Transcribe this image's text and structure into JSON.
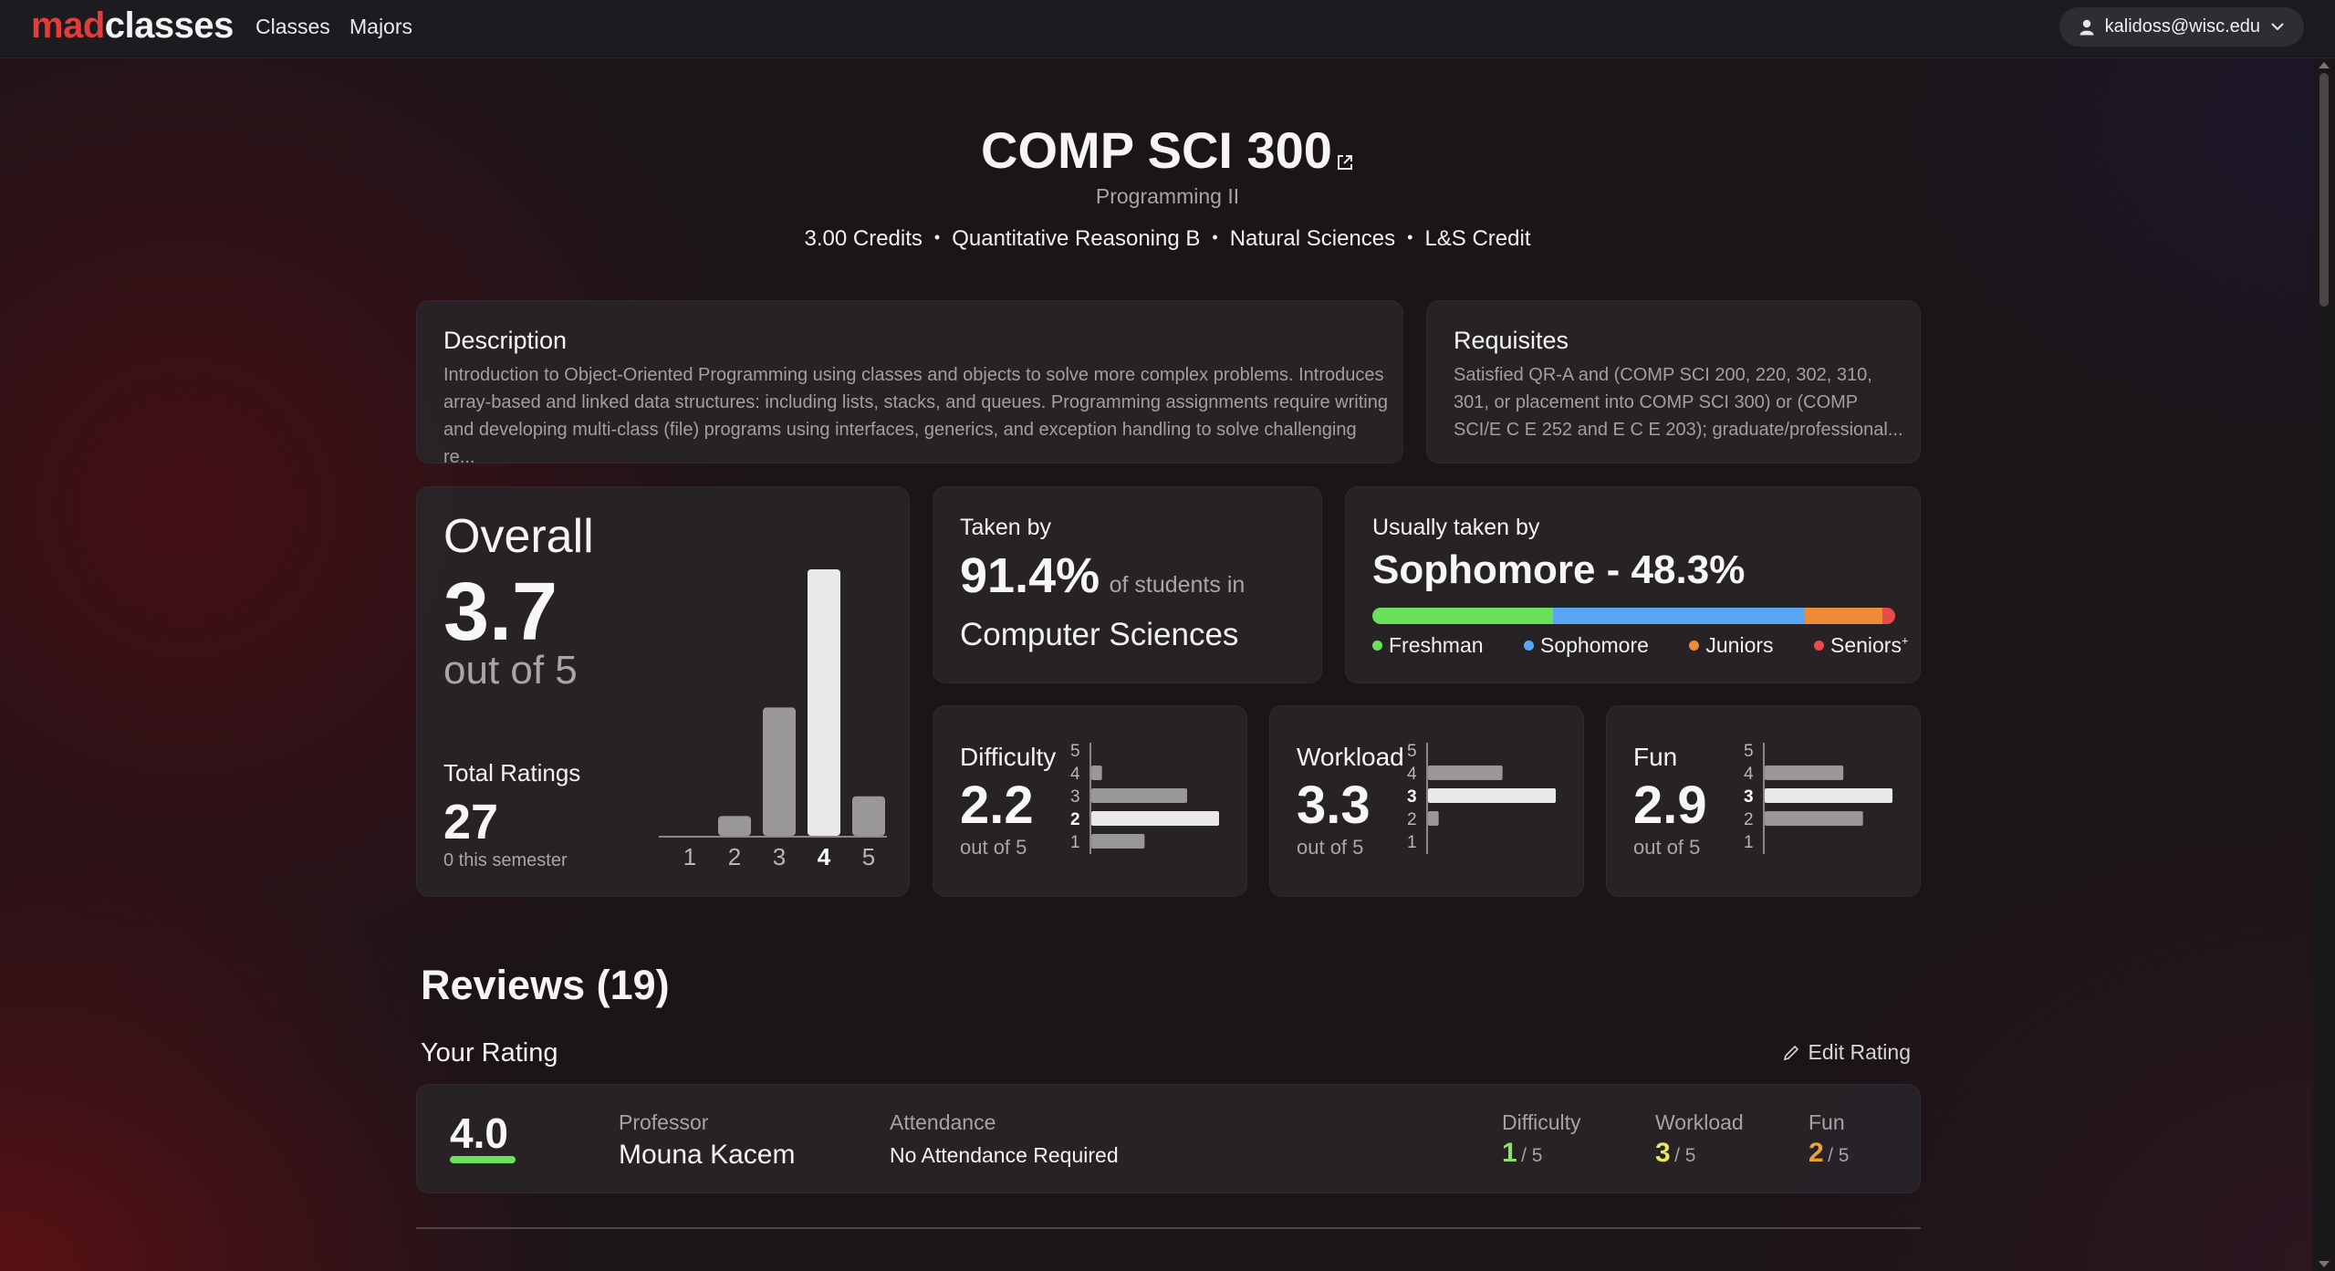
{
  "nav": {
    "logo_mad": "mad",
    "logo_classes": "classes",
    "links": [
      "Classes",
      "Majors"
    ],
    "user_email": "kalidoss@wisc.edu"
  },
  "course": {
    "code": "COMP SCI 300",
    "name": "Programming II",
    "meta": [
      "3.00 Credits",
      "Quantitative Reasoning B",
      "Natural Sciences",
      "L&S Credit"
    ]
  },
  "description": {
    "title": "Description",
    "lines": [
      "Introduction to Object-Oriented Programming using classes and objects to solve more complex problems. Introduces",
      "array-based and linked data structures: including lists, stacks, and queues. Programming assignments require writing",
      "and developing multi-class (file) programs using interfaces, generics, and exception handling to solve challenging re..."
    ]
  },
  "requisites": {
    "title": "Requisites",
    "lines": [
      "Satisfied QR-A and (COMP SCI 200, 220, 302, 310,",
      "301, or placement into COMP SCI 300) or (COMP",
      "SCI/E C E 252 and E C E 203); graduate/professional..."
    ]
  },
  "overall": {
    "label": "Overall",
    "value": "3.7",
    "out_of": "out of 5",
    "total_label": "Total Ratings",
    "total": "27",
    "semester_note": "0 this semester"
  },
  "chart_data": [
    {
      "type": "bar",
      "categories": [
        "1",
        "2",
        "3",
        "4",
        "5"
      ],
      "values": [
        0,
        2,
        13,
        27,
        4
      ],
      "highlight": "4",
      "title": "",
      "xlabel": "",
      "ylabel": ""
    },
    {
      "type": "bar",
      "orientation": "horizontal",
      "title": "Difficulty",
      "categories": [
        "5",
        "4",
        "3",
        "2",
        "1"
      ],
      "values": [
        0,
        1,
        9,
        12,
        5
      ],
      "highlight": "2"
    },
    {
      "type": "bar",
      "orientation": "horizontal",
      "title": "Workload",
      "categories": [
        "5",
        "4",
        "3",
        "2",
        "1"
      ],
      "values": [
        0,
        7,
        12,
        1,
        0
      ],
      "highlight": "3"
    },
    {
      "type": "bar",
      "orientation": "horizontal",
      "title": "Fun",
      "categories": [
        "5",
        "4",
        "3",
        "2",
        "1"
      ],
      "values": [
        0,
        8,
        13,
        10,
        0
      ],
      "highlight": "3"
    }
  ],
  "taken_by": {
    "label": "Taken by",
    "percent": "91.4%",
    "suffix": "of students in",
    "major": "Computer Sciences"
  },
  "usually_taken": {
    "label": "Usually taken by",
    "value": "Sophomore - 48.3%",
    "segments": [
      {
        "name": "Freshman",
        "fraction": 0.345,
        "color": "#6be05a"
      },
      {
        "name": "Sophomore",
        "fraction": 0.483,
        "color": "#5aa6f5"
      },
      {
        "name": "Juniors",
        "fraction": 0.148,
        "color": "#ef8b37"
      },
      {
        "name": "Seniors",
        "fraction": 0.024,
        "color": "#ea4a4a"
      }
    ],
    "seniors_sup": "+"
  },
  "difficulty": {
    "title": "Difficulty",
    "value": "2.2",
    "out_of": "out of 5"
  },
  "workload": {
    "title": "Workload",
    "value": "3.3",
    "out_of": "out of 5"
  },
  "fun": {
    "title": "Fun",
    "value": "2.9",
    "out_of": "out of 5"
  },
  "reviews": {
    "title": "Reviews (19)",
    "your_rating": "Your Rating",
    "edit": "Edit Rating",
    "rating": {
      "score": "4.0",
      "score_bar_color": "#6be05a",
      "professor_label": "Professor",
      "professor": "Mouna Kacem",
      "attendance_label": "Attendance",
      "attendance": "No Attendance Required",
      "difficulty_label": "Difficulty",
      "difficulty": "1",
      "difficulty_color": "#8fe06a",
      "workload_label": "Workload",
      "workload": "3",
      "workload_color": "#e8e85a",
      "fun_label": "Fun",
      "fun": "2",
      "fun_color": "#e8a23a",
      "denom": "/ 5"
    }
  }
}
